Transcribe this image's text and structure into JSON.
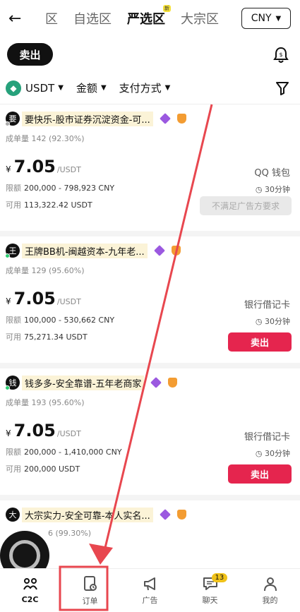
{
  "header": {
    "back_icon": "arrow-left-icon",
    "tabs": [
      "区",
      "自选区",
      "严选区",
      "大宗区"
    ],
    "new_badge": "新",
    "currency": "CNY"
  },
  "action": {
    "sell_label": "卖出"
  },
  "filters": {
    "coin": "USDT",
    "amount": "金额",
    "payment": "支付方式"
  },
  "listings": [
    {
      "avatar": "要",
      "status_color": "#aaaaaa",
      "merchant": "要快乐-股市证券沉淀资金-可...",
      "volume_label": "成单量",
      "volume": "142 (92.30%)",
      "currency_symbol": "¥",
      "price": "7.05",
      "price_unit": "/USDT",
      "limit_label": "限额",
      "limit": "200,000 - 798,923 CNY",
      "available_label": "可用",
      "available": "113,322.42 USDT",
      "payment": "QQ 钱包",
      "time": "30分钟",
      "button": "不满足广告方要求",
      "button_disabled": true
    },
    {
      "avatar": "王",
      "status_color": "#2ecc71",
      "merchant": "王牌BB机-闽越资本-九年老...",
      "volume_label": "成单量",
      "volume": "129 (95.60%)",
      "currency_symbol": "¥",
      "price": "7.05",
      "price_unit": "/USDT",
      "limit_label": "限额",
      "limit": "100,000 - 530,662 CNY",
      "available_label": "可用",
      "available": "75,271.34 USDT",
      "payment": "银行借记卡",
      "time": "30分钟",
      "button": "卖出",
      "button_disabled": false
    },
    {
      "avatar": "钱",
      "status_color": "#2ecc71",
      "merchant": "钱多多-安全靠谱-五年老商家",
      "volume_label": "成单量",
      "volume": "193 (95.60%)",
      "currency_symbol": "¥",
      "price": "7.05",
      "price_unit": "/USDT",
      "limit_label": "限额",
      "limit": "200,000 - 1,410,000 CNY",
      "available_label": "可用",
      "available": "200,000 USDT",
      "payment": "银行借记卡",
      "time": "30分钟",
      "button": "卖出",
      "button_disabled": false
    }
  ],
  "partial_listing": {
    "avatar": "大",
    "merchant": "大宗实力-安全可靠-本人实名...",
    "volume": "6 (99.30%)"
  },
  "bottom_nav": [
    {
      "label": "C2C",
      "icon": "c2c-icon"
    },
    {
      "label": "订单",
      "icon": "order-icon"
    },
    {
      "label": "广告",
      "icon": "megaphone-icon"
    },
    {
      "label": "聊天",
      "icon": "chat-icon",
      "badge": "13"
    },
    {
      "label": "我的",
      "icon": "profile-icon"
    }
  ],
  "colors": {
    "sell": "#e5254e",
    "accent_red": "#e8474f",
    "usdt": "#26a17b"
  }
}
